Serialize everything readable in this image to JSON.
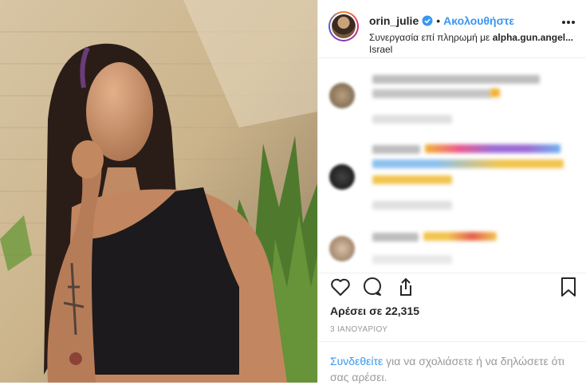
{
  "post": {
    "username": "orin_julie",
    "follow_label": "Ακολουθήστε",
    "partnership_prefix": "Συνεργασία επί πληρωμή με ",
    "partner": "alpha.gun.angel...",
    "location": "Israel",
    "likes_text": "Αρέσει σε 22,315",
    "date_text": "3 ΙΑΝΟΥΑΡΙΟΥ",
    "login_link": "Συνδεθείτε",
    "login_rest": " για να σχολιάσετε ή να δηλώσετε ότι σας αρέσει.",
    "separator": "•"
  },
  "icons": {
    "verified": "verified-badge-icon",
    "more": "more-options-icon",
    "like": "heart-icon",
    "comment": "comment-icon",
    "share": "share-icon",
    "save": "bookmark-icon"
  },
  "colors": {
    "accent": "#3897f0",
    "text": "#262626",
    "muted": "#999999"
  }
}
